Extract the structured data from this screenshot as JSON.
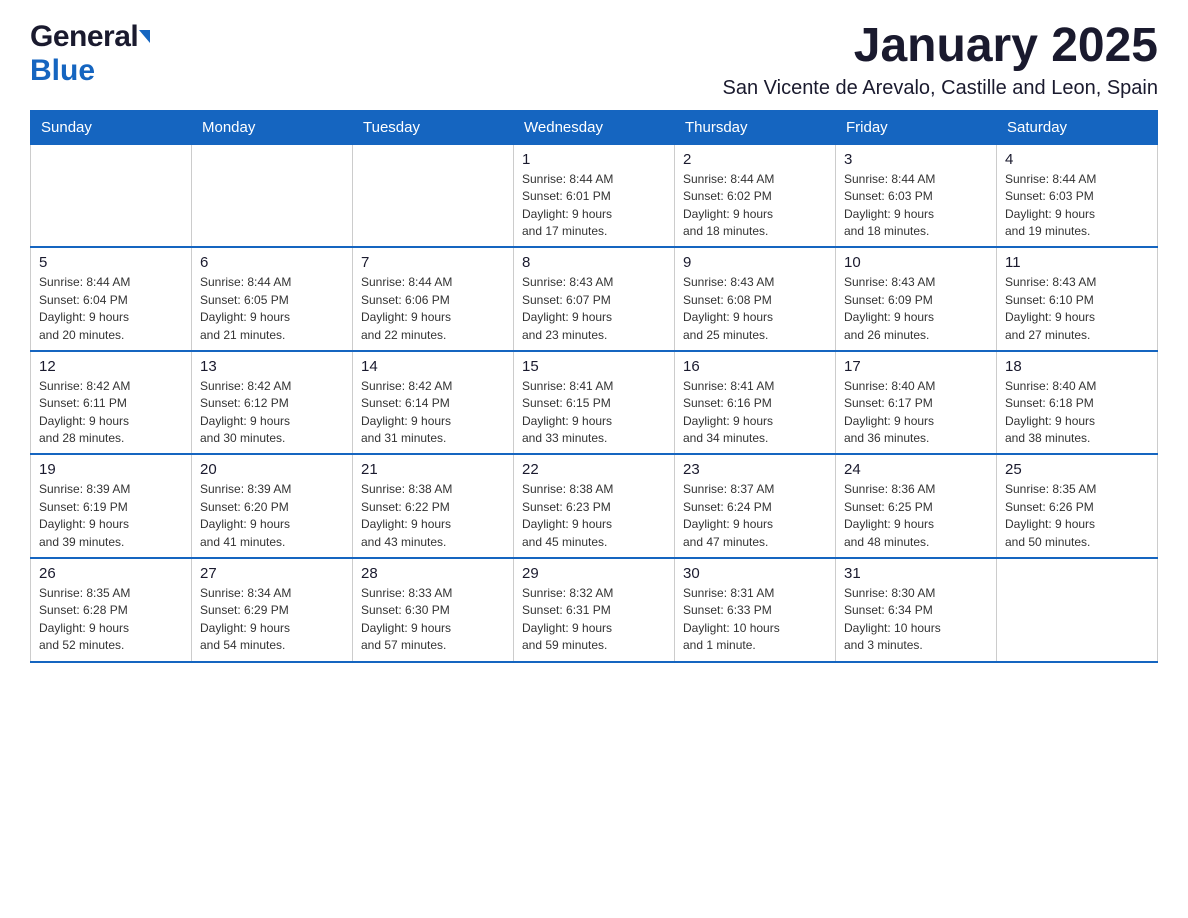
{
  "header": {
    "month_title": "January 2025",
    "location": "San Vicente de Arevalo, Castille and Leon, Spain",
    "logo_part1": "General",
    "logo_part2": "Blue"
  },
  "days_of_week": [
    "Sunday",
    "Monday",
    "Tuesday",
    "Wednesday",
    "Thursday",
    "Friday",
    "Saturday"
  ],
  "weeks": [
    [
      {
        "day": "",
        "info": ""
      },
      {
        "day": "",
        "info": ""
      },
      {
        "day": "",
        "info": ""
      },
      {
        "day": "1",
        "info": "Sunrise: 8:44 AM\nSunset: 6:01 PM\nDaylight: 9 hours\nand 17 minutes."
      },
      {
        "day": "2",
        "info": "Sunrise: 8:44 AM\nSunset: 6:02 PM\nDaylight: 9 hours\nand 18 minutes."
      },
      {
        "day": "3",
        "info": "Sunrise: 8:44 AM\nSunset: 6:03 PM\nDaylight: 9 hours\nand 18 minutes."
      },
      {
        "day": "4",
        "info": "Sunrise: 8:44 AM\nSunset: 6:03 PM\nDaylight: 9 hours\nand 19 minutes."
      }
    ],
    [
      {
        "day": "5",
        "info": "Sunrise: 8:44 AM\nSunset: 6:04 PM\nDaylight: 9 hours\nand 20 minutes."
      },
      {
        "day": "6",
        "info": "Sunrise: 8:44 AM\nSunset: 6:05 PM\nDaylight: 9 hours\nand 21 minutes."
      },
      {
        "day": "7",
        "info": "Sunrise: 8:44 AM\nSunset: 6:06 PM\nDaylight: 9 hours\nand 22 minutes."
      },
      {
        "day": "8",
        "info": "Sunrise: 8:43 AM\nSunset: 6:07 PM\nDaylight: 9 hours\nand 23 minutes."
      },
      {
        "day": "9",
        "info": "Sunrise: 8:43 AM\nSunset: 6:08 PM\nDaylight: 9 hours\nand 25 minutes."
      },
      {
        "day": "10",
        "info": "Sunrise: 8:43 AM\nSunset: 6:09 PM\nDaylight: 9 hours\nand 26 minutes."
      },
      {
        "day": "11",
        "info": "Sunrise: 8:43 AM\nSunset: 6:10 PM\nDaylight: 9 hours\nand 27 minutes."
      }
    ],
    [
      {
        "day": "12",
        "info": "Sunrise: 8:42 AM\nSunset: 6:11 PM\nDaylight: 9 hours\nand 28 minutes."
      },
      {
        "day": "13",
        "info": "Sunrise: 8:42 AM\nSunset: 6:12 PM\nDaylight: 9 hours\nand 30 minutes."
      },
      {
        "day": "14",
        "info": "Sunrise: 8:42 AM\nSunset: 6:14 PM\nDaylight: 9 hours\nand 31 minutes."
      },
      {
        "day": "15",
        "info": "Sunrise: 8:41 AM\nSunset: 6:15 PM\nDaylight: 9 hours\nand 33 minutes."
      },
      {
        "day": "16",
        "info": "Sunrise: 8:41 AM\nSunset: 6:16 PM\nDaylight: 9 hours\nand 34 minutes."
      },
      {
        "day": "17",
        "info": "Sunrise: 8:40 AM\nSunset: 6:17 PM\nDaylight: 9 hours\nand 36 minutes."
      },
      {
        "day": "18",
        "info": "Sunrise: 8:40 AM\nSunset: 6:18 PM\nDaylight: 9 hours\nand 38 minutes."
      }
    ],
    [
      {
        "day": "19",
        "info": "Sunrise: 8:39 AM\nSunset: 6:19 PM\nDaylight: 9 hours\nand 39 minutes."
      },
      {
        "day": "20",
        "info": "Sunrise: 8:39 AM\nSunset: 6:20 PM\nDaylight: 9 hours\nand 41 minutes."
      },
      {
        "day": "21",
        "info": "Sunrise: 8:38 AM\nSunset: 6:22 PM\nDaylight: 9 hours\nand 43 minutes."
      },
      {
        "day": "22",
        "info": "Sunrise: 8:38 AM\nSunset: 6:23 PM\nDaylight: 9 hours\nand 45 minutes."
      },
      {
        "day": "23",
        "info": "Sunrise: 8:37 AM\nSunset: 6:24 PM\nDaylight: 9 hours\nand 47 minutes."
      },
      {
        "day": "24",
        "info": "Sunrise: 8:36 AM\nSunset: 6:25 PM\nDaylight: 9 hours\nand 48 minutes."
      },
      {
        "day": "25",
        "info": "Sunrise: 8:35 AM\nSunset: 6:26 PM\nDaylight: 9 hours\nand 50 minutes."
      }
    ],
    [
      {
        "day": "26",
        "info": "Sunrise: 8:35 AM\nSunset: 6:28 PM\nDaylight: 9 hours\nand 52 minutes."
      },
      {
        "day": "27",
        "info": "Sunrise: 8:34 AM\nSunset: 6:29 PM\nDaylight: 9 hours\nand 54 minutes."
      },
      {
        "day": "28",
        "info": "Sunrise: 8:33 AM\nSunset: 6:30 PM\nDaylight: 9 hours\nand 57 minutes."
      },
      {
        "day": "29",
        "info": "Sunrise: 8:32 AM\nSunset: 6:31 PM\nDaylight: 9 hours\nand 59 minutes."
      },
      {
        "day": "30",
        "info": "Sunrise: 8:31 AM\nSunset: 6:33 PM\nDaylight: 10 hours\nand 1 minute."
      },
      {
        "day": "31",
        "info": "Sunrise: 8:30 AM\nSunset: 6:34 PM\nDaylight: 10 hours\nand 3 minutes."
      },
      {
        "day": "",
        "info": ""
      }
    ]
  ]
}
